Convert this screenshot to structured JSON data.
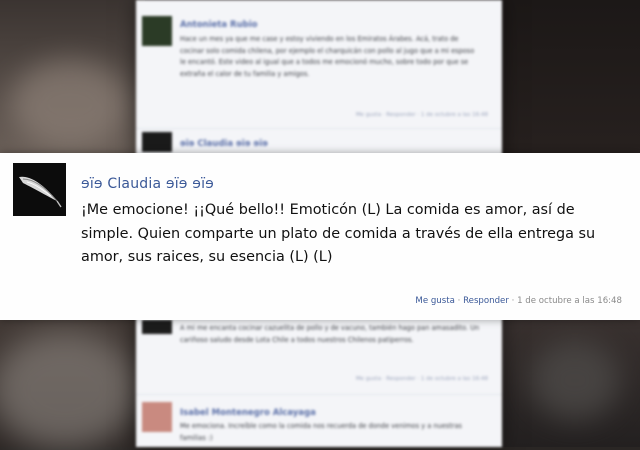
{
  "background_comments": [
    {
      "name": "Antonieta Rubio",
      "text": "Hace un mes ya que me case y estoy viviendo en los Emiratos Árabes. Acá, trato de cocinar solo comida chilena, por ejemplo el charquicán con pollo al jugo que a mi esposo le encantó. Este video al igual que a todos me emocionó mucho, sobre todo por que se extraña el calor de tu familia y amigos.",
      "meta": "Me gusta · Responder · 1 de octubre a las 16:48"
    },
    {
      "name": "ɘïɘ Claudia ɘïɘ ɘïɘ",
      "text": "",
      "meta": ""
    },
    {
      "name": "",
      "text": "A mi me encanta cocinar cazuelita de pollo y de vacuno, también hago pan amasadito. Un cariñoso saludo desde Lota Chile a todos nuestros Chilenos patiperros.",
      "meta": "Me gusta · Responder · 1 de octubre a las 16:48"
    },
    {
      "name": "Isabel Montenegro Alcayaga",
      "text": "Me emociona. Increíble como la comida nos recuerda de donde venimos y a nuestras familias :)",
      "meta": ""
    }
  ],
  "highlighted_comment": {
    "name": "ɘïɘ Claudia ɘïɘ ɘïɘ",
    "text": "¡Me emocione! ¡¡Qué bello!! Emoticón (L) La comida es amor, así de simple. Quien comparte un plato de comida a través de ella entrega su amor, sus raices, su esencia  (L) (L)",
    "like_label": "Me gusta",
    "reply_label": "Responder",
    "separator": "·",
    "timestamp": "1 de octubre a las 16:48"
  },
  "colors": {
    "link": "#3b5998",
    "meta": "#8a8a8a"
  }
}
